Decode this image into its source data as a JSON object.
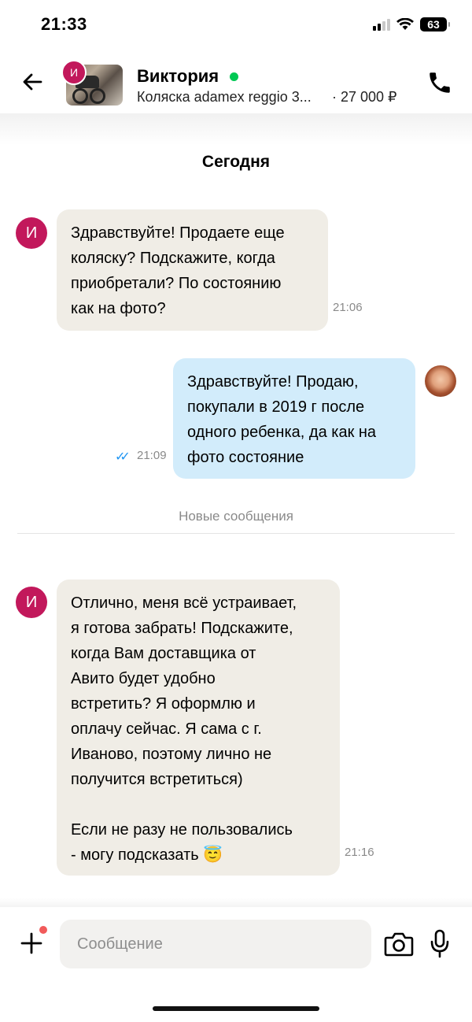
{
  "status_bar": {
    "time": "21:33",
    "battery": "63"
  },
  "header": {
    "avatar_letter": "И",
    "contact_name": "Виктория",
    "item_title": "Коляска adamex reggio 3...",
    "item_price": "· 27 000 ₽"
  },
  "chat": {
    "date_label": "Сегодня",
    "new_messages_label": "Новые сообщения",
    "messages": [
      {
        "from": "them",
        "avatar": "И",
        "text": "Здравствуйте! Продаете еще\nколяску? Подскажите, когда\nприобретали? По состоянию\nкак на фото?",
        "time": "21:06"
      },
      {
        "from": "me",
        "text": "Здравствуйте! Продаю,\nпокупали в 2019 г после\nодного ребенка, да как на\nфото состояние",
        "time": "21:09",
        "read": true
      },
      {
        "from": "them",
        "avatar": "И",
        "text": "Отлично, меня всё устраивает,\nя готова забрать! Подскажите,\nкогда Вам доставщика от\nАвито будет удобно\nвстретить? Я оформлю и\nоплачу сейчас. Я сама с г.\nИваново, поэтому лично не\nполучится встретиться)\n\nЕсли не разу не пользовались\n- могу подсказать 😇",
        "time": "21:16"
      }
    ]
  },
  "composer": {
    "placeholder": "Сообщение"
  },
  "colors": {
    "avatar": "#c2185b",
    "incoming_bubble": "#f0ede6",
    "outgoing_bubble": "#d2ecfb",
    "online": "#00c853",
    "read_checks": "#2196f3"
  }
}
